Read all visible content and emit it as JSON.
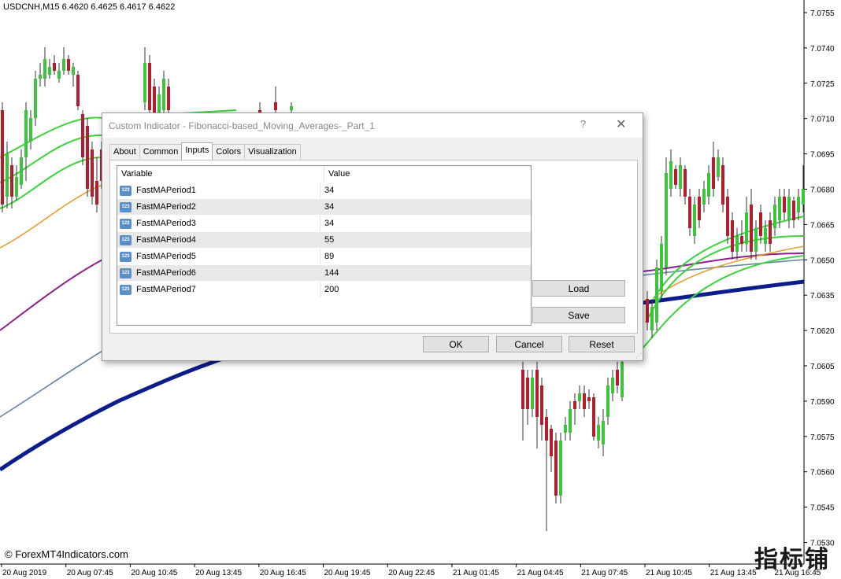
{
  "chart": {
    "header": "USDCNH,M15  6.4620 6.4625 6.4617 6.4622",
    "price_labels": [
      "7.0755",
      "7.0740",
      "7.0725",
      "7.0710",
      "7.0695",
      "7.0680",
      "7.0665",
      "7.0650",
      "7.0635",
      "7.0620",
      "7.0605",
      "7.0590",
      "7.0575",
      "7.0560",
      "7.0545",
      "7.0530"
    ],
    "time_labels": [
      "20 Aug 2019",
      "20 Aug 07:45",
      "20 Aug 10:45",
      "20 Aug 13:45",
      "20 Aug 16:45",
      "20 Aug 19:45",
      "20 Aug 22:45",
      "21 Aug 01:45",
      "21 Aug 04:45",
      "21 Aug 07:45",
      "21 Aug 10:45",
      "21 Aug 13:45",
      "21 Aug 16:45"
    ],
    "watermark": "© ForexMT4Indicators.com",
    "corner_logo": "指标铺",
    "colors": {
      "bull": "#3cc43c",
      "bear": "#b31e2e",
      "ma_fast": "#3ad43a",
      "ma_orange": "#e79a2a",
      "ma_purple": "#8e1e8e",
      "ma_steel": "#5f7fa5",
      "ma_navy": "#0b1c8c"
    }
  },
  "dialog": {
    "title": "Custom Indicator - Fibonacci-based_Moving_Averages-_Part_1",
    "help_glyph": "?",
    "close_glyph": "✕",
    "tabs": [
      {
        "label": "About",
        "active": false
      },
      {
        "label": "Common",
        "active": false
      },
      {
        "label": "Inputs",
        "active": true
      },
      {
        "label": "Colors",
        "active": false
      },
      {
        "label": "Visualization",
        "active": false
      }
    ],
    "grid": {
      "headers": {
        "variable": "Variable",
        "value": "Value"
      },
      "icon_text": "123",
      "rows": [
        {
          "variable": "FastMAPeriod1",
          "value": "34"
        },
        {
          "variable": "FastMAPeriod2",
          "value": "34"
        },
        {
          "variable": "FastMAPeriod3",
          "value": "34"
        },
        {
          "variable": "FastMAPeriod4",
          "value": "55"
        },
        {
          "variable": "FastMAPeriod5",
          "value": "89"
        },
        {
          "variable": "FastMAPeriod6",
          "value": "144"
        },
        {
          "variable": "FastMAPeriod7",
          "value": "200"
        }
      ]
    },
    "buttons": {
      "load": "Load",
      "save": "Save",
      "ok": "OK",
      "cancel": "Cancel",
      "reset": "Reset"
    }
  }
}
